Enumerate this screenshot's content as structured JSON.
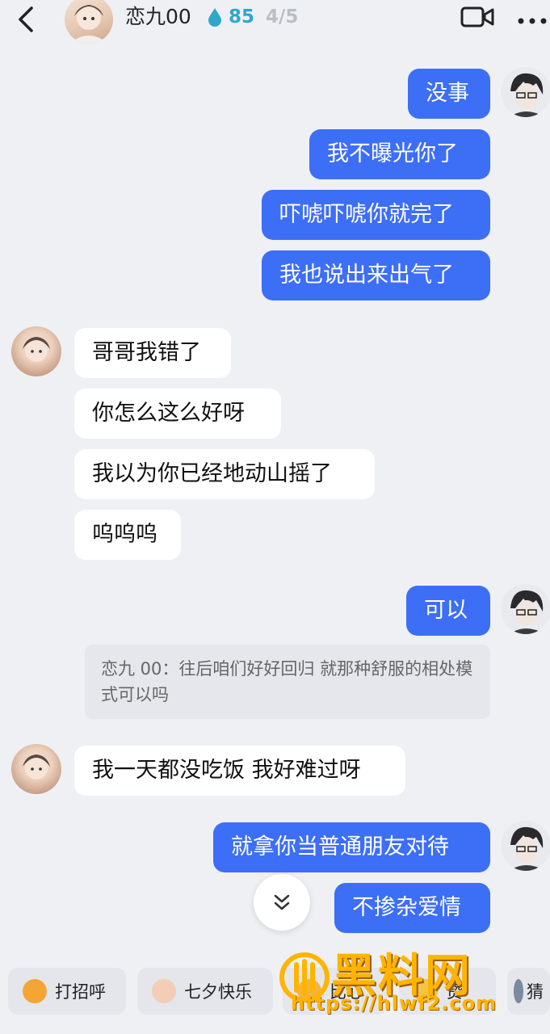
{
  "header": {
    "contact_name": "恋九00",
    "score": "85",
    "page": "4/5"
  },
  "messages_out_1": [
    "没事",
    "我不曝光你了",
    "吓唬吓唬你就完了",
    "我也说出来出气了"
  ],
  "messages_in_1": [
    "哥哥我错了",
    "你怎么这么好呀",
    "我以为你已经地动山摇了",
    "呜呜呜"
  ],
  "reply_ok": "可以",
  "quote": "恋九 00：往后咱们好好回归 就那种舒服的相处模式可以吗",
  "message_in_2": "我一天都没吃饭 我好难过呀",
  "messages_out_2": [
    "就拿你当普通朋友对待",
    "不掺杂爱情"
  ],
  "quick_replies": [
    "打招呼",
    "七夕快乐",
    "比心",
    "赞",
    "猜"
  ],
  "watermark": {
    "title": "黑料网",
    "url": "https://hlwf2.com"
  },
  "colors": {
    "outgoing": "#3d6ef6",
    "incoming": "#ffffff",
    "background": "#eef0f4",
    "watermark": "#ffb400"
  }
}
